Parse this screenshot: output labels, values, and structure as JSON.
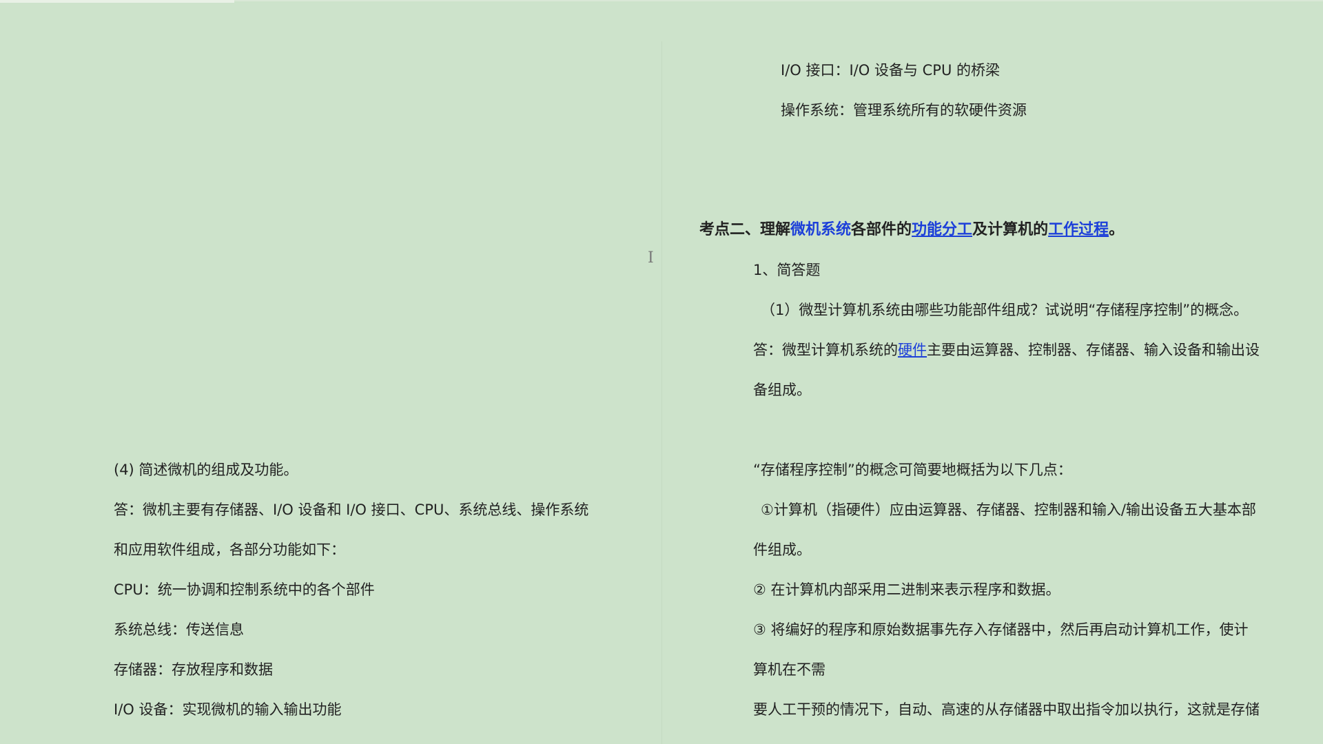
{
  "left_page": {
    "question4": "(4) 简述微机的组成及功能。",
    "answer_line1": "答：微机主要有存储器、I/O 设备和 I/O 接口、CPU、系统总线、操作系统",
    "answer_line2": "和应用软件组成，各部分功能如下：",
    "cpu": "CPU：统一协调和控制系统中的各个部件",
    "bus": "系统总线：传送信息",
    "memory": "存储器：存放程序和数据",
    "io_device": "I/O 设备：实现微机的输入输出功能"
  },
  "right_page": {
    "io_interface": "I/O 接口：I/O 设备与 CPU 的桥梁",
    "os": "操作系统：管理系统所有的软硬件资源",
    "heading": {
      "part1": "考点二、理解",
      "link1": "微机系统",
      "part2": "各部件的",
      "link2": "功能分工",
      "part3": "及计算机的",
      "link3": "工作过程",
      "part4": "。"
    },
    "section": "1、简答题",
    "q1": "（1）微型计算机系统由哪些功能部件组成？试说明“存储程序控制”的概念。",
    "a1_prefix": "答：微型计算机系统的",
    "a1_link": "硬件",
    "a1_suffix": "主要由运算器、控制器、存储器、输入设备和输出设",
    "a1_line2": "备组成。",
    "concept_intro": "“存储程序控制”的概念可简要地概括为以下几点：",
    "point1_line1": "①计算机（指硬件）应由运算器、存储器、控制器和输入/输出设备五大基本部",
    "point1_line2": "件组成。",
    "point2": "② 在计算机内部采用二进制来表示程序和数据。",
    "point3_line1": "③ 将编好的程序和原始数据事先存入存储器中，然后再启动计算机工作，使计",
    "point3_line2": "算机在不需",
    "point3_line3": "要人工干预的情况下，自动、高速的从存储器中取出指令加以执行，这就是存储"
  },
  "cursor_glyph": "I",
  "colors": {
    "background": "#cde3cb",
    "link": "#1c3fd9",
    "text": "#222222"
  }
}
